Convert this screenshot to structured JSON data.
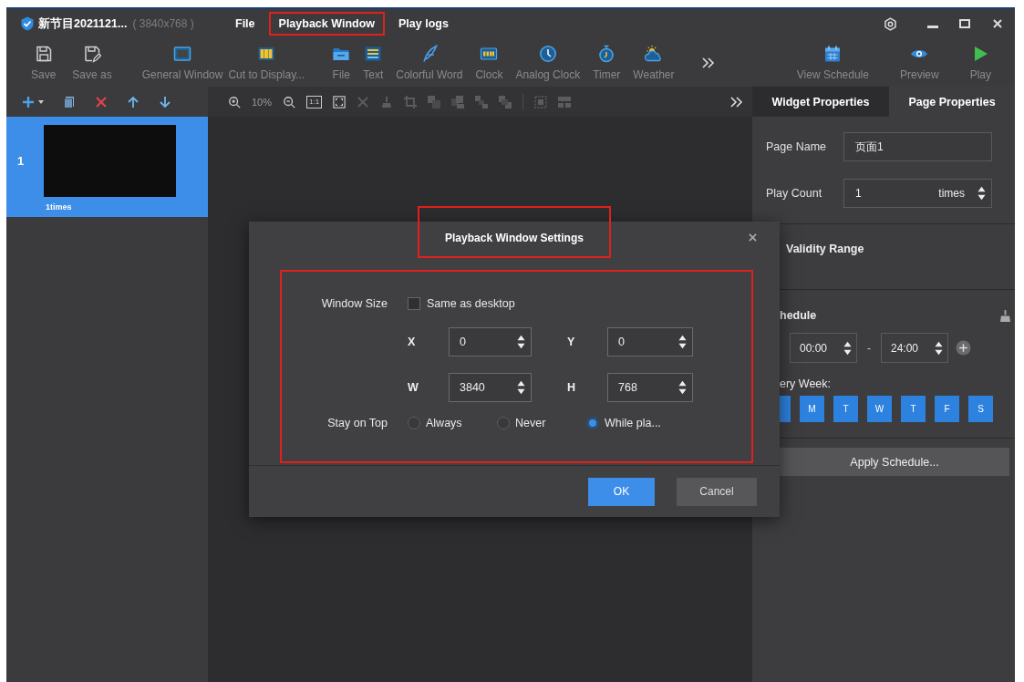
{
  "window": {
    "title": "新节目2021121...",
    "resolution": "( 3840x768 )"
  },
  "menu": [
    {
      "label": "File",
      "highlighted": false
    },
    {
      "label": "Playback Window",
      "highlighted": true
    },
    {
      "label": "Play logs",
      "highlighted": false
    }
  ],
  "toolbar": {
    "groups": [
      {
        "items": [
          {
            "label": "Save"
          },
          {
            "label": "Save as"
          }
        ]
      },
      {
        "items": [
          {
            "label": "General Window"
          },
          {
            "label": "Cut to Display..."
          }
        ]
      },
      {
        "items": [
          {
            "label": "File"
          },
          {
            "label": "Text"
          },
          {
            "label": "Colorful Word"
          },
          {
            "label": "Clock"
          },
          {
            "label": "Analog Clock"
          },
          {
            "label": "Timer"
          },
          {
            "label": "Weather"
          }
        ]
      }
    ],
    "right_items": [
      {
        "label": "View Schedule"
      },
      {
        "label": "Preview"
      },
      {
        "label": "Play"
      }
    ]
  },
  "canvas_tools": {
    "zoom": "10%",
    "actual_size": "1:1"
  },
  "properties_tabs": [
    {
      "label": "Widget Properties",
      "selected": false
    },
    {
      "label": "Page Properties",
      "selected": true
    }
  ],
  "pages": [
    {
      "number": "1",
      "label": "1times",
      "selected": true
    }
  ],
  "page_properties": {
    "page_name": {
      "label": "Page Name",
      "value": "页面1"
    },
    "play_count": {
      "label": "Play Count",
      "value": "1",
      "unit": "times"
    },
    "validity_range": {
      "label": "Validity Range"
    },
    "schedule": {
      "label": "hedule",
      "start": "00:00",
      "separator": "-",
      "end": "24:00"
    },
    "every_week": {
      "label": "ery Week:",
      "days": [
        {
          "selected": true
        },
        {
          "label": "M",
          "selected": true
        },
        {
          "label": "T",
          "selected": true
        },
        {
          "label": "W",
          "selected": true
        },
        {
          "label": "T",
          "selected": true
        },
        {
          "label": "F",
          "selected": true
        },
        {
          "label": "S",
          "selected": true
        }
      ]
    },
    "apply_button": "Apply Schedule..."
  },
  "dialog": {
    "title": "Playback Window Settings",
    "title_highlighted": true,
    "body_highlighted": true,
    "window_size": {
      "label": "Window Size",
      "option": "Same as desktop",
      "checked": false
    },
    "position_fields": [
      {
        "label": "X",
        "value": "0"
      },
      {
        "label": "Y",
        "value": "0"
      },
      {
        "label": "W",
        "value": "3840"
      },
      {
        "label": "H",
        "value": "768"
      }
    ],
    "stay_on_top": {
      "label": "Stay on Top",
      "options": [
        {
          "label": "Always",
          "selected": false
        },
        {
          "label": "Never",
          "selected": false
        },
        {
          "label": "While pla...",
          "selected": true
        }
      ]
    },
    "buttons": [
      {
        "label": "OK",
        "primary": true
      },
      {
        "label": "Cancel",
        "primary": false
      }
    ]
  }
}
